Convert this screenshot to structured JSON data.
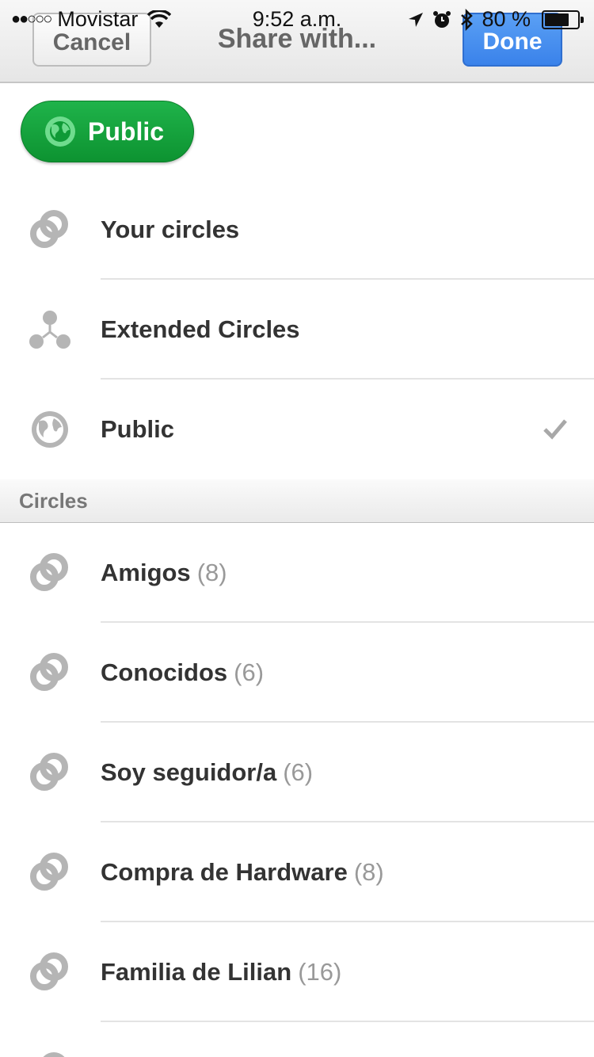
{
  "status_bar": {
    "signal": "●●○○○",
    "carrier": "Movistar",
    "time": "9:52 a.m.",
    "battery": "80 %",
    "battery_level": 0.8
  },
  "nav": {
    "cancel_label": "Cancel",
    "title": "Share with...",
    "done_label": "Done",
    "done_color": "#3a82ea"
  },
  "selected": {
    "chip_label": "Public",
    "chip_color": "#12a03b"
  },
  "audiences": [
    {
      "label": "Your circles",
      "icon": "circles-icon"
    },
    {
      "label": "Extended Circles",
      "icon": "extended-circles-icon"
    },
    {
      "label": "Public",
      "icon": "globe-icon",
      "checked": true
    }
  ],
  "section": {
    "title": "Circles"
  },
  "circles": [
    {
      "name": "Amigos",
      "count": "(8)"
    },
    {
      "name": "Conocidos",
      "count": "(6)"
    },
    {
      "name": "Soy seguidor/a",
      "count": "(6)"
    },
    {
      "name": "Compra de Hardware",
      "count": "(8)"
    },
    {
      "name": "Familia de Lilian",
      "count": "(16)"
    }
  ]
}
